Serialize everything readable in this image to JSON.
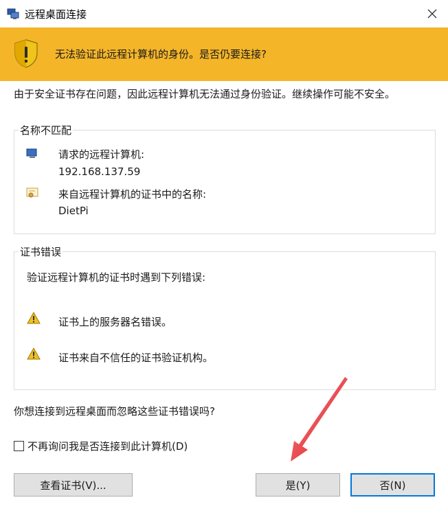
{
  "window": {
    "title": "远程桌面连接"
  },
  "banner": {
    "text": "无法验证此远程计算机的身份。是否仍要连接?"
  },
  "intro": "由于安全证书存在问题，因此远程计算机无法通过身份验证。继续操作可能不安全。",
  "mismatch": {
    "legend": "名称不匹配",
    "requested_label": "请求的远程计算机:",
    "requested_value": "192.168.137.59",
    "cert_label": "来自远程计算机的证书中的名称:",
    "cert_value": "DietPi"
  },
  "cert_errors": {
    "legend": "证书错误",
    "intro": "验证远程计算机的证书时遇到下列错误:",
    "items": [
      "证书上的服务器名错误。",
      "证书来自不信任的证书验证机构。"
    ]
  },
  "question": "你想连接到远程桌面而忽略这些证书错误吗?",
  "checkbox": {
    "label": "不再询问我是否连接到此计算机(D)",
    "checked": false
  },
  "buttons": {
    "view_cert": "查看证书(V)...",
    "yes": "是(Y)",
    "no": "否(N)"
  },
  "colors": {
    "banner": "#f4b529",
    "accent": "#0078d7",
    "arrow": "#e8262b"
  },
  "icons": {
    "app": "remote-desktop-icon",
    "banner": "warning-shield-icon",
    "computer": "computer-icon",
    "certificate": "certificate-icon",
    "warning": "warning-triangle-icon",
    "close": "close-icon"
  }
}
